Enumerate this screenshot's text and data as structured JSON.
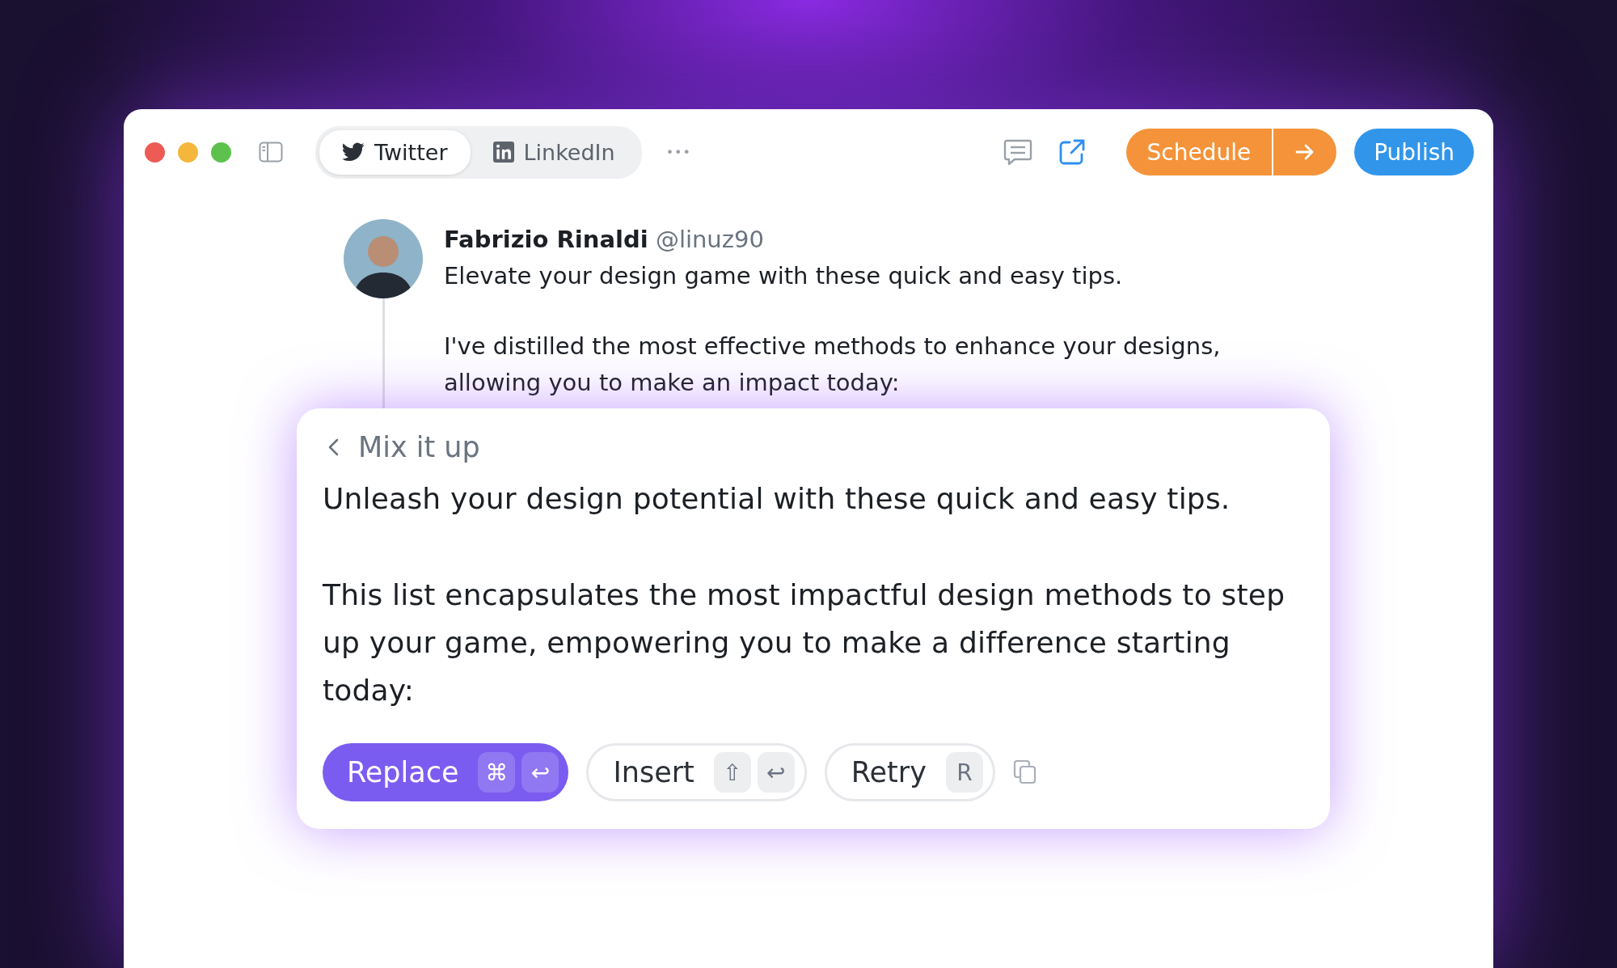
{
  "tabs": [
    {
      "label": "Twitter",
      "kind": "twitter",
      "selected": true
    },
    {
      "label": "LinkedIn",
      "kind": "linkedin",
      "selected": false
    }
  ],
  "more": "•••",
  "actions": {
    "schedule": "Schedule",
    "publish": "Publish"
  },
  "tweet": {
    "name": "Fabrizio Rinaldi",
    "handle": "@linuz90",
    "paragraphs": [
      "Elevate your design game with these quick and easy tips.",
      "I've distilled the most effective methods to enhance your designs, allowing you to make an impact today:"
    ]
  },
  "card": {
    "title": "Mix it up",
    "paragraphs": [
      "Unleash your design potential with these quick and easy tips.",
      "This list encapsulates the most impactful design methods to step up your game, empowering you to make a difference starting today:"
    ],
    "buttons": [
      {
        "label": "Replace",
        "kind": "primary",
        "keys": [
          "⌘",
          "↩"
        ]
      },
      {
        "label": "Insert",
        "kind": "secondary",
        "keys": [
          "⇧",
          "↩"
        ]
      },
      {
        "label": "Retry",
        "kind": "secondary",
        "keys": [
          "R"
        ]
      }
    ]
  }
}
